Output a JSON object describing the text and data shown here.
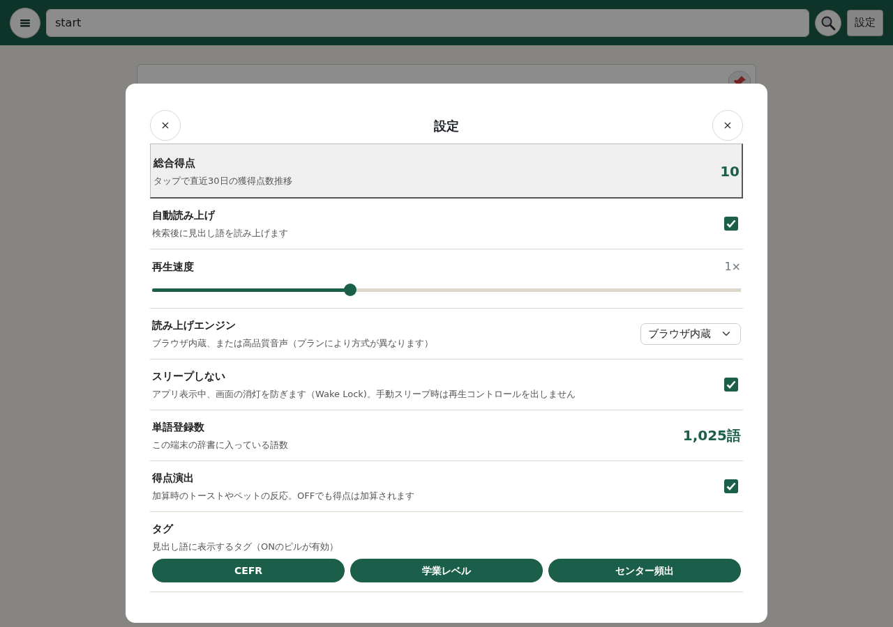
{
  "topbar": {
    "search_value": "start",
    "settings_button": "設定"
  },
  "modal": {
    "title": "設定",
    "close_buttons": [
      "×",
      "×"
    ],
    "rows": [
      {
        "kind": "score",
        "label": "総合得点",
        "description": "タップで直近30日の獲得点数推移",
        "value": "10",
        "selected": true
      },
      {
        "kind": "checkbox",
        "label": "自動読み上げ",
        "description": "検索後に見出し語を読み上げます",
        "checked": true
      },
      {
        "kind": "slider",
        "label": "再生速度",
        "reading": "1×",
        "level": 0.336
      },
      {
        "kind": "select",
        "label": "読み上げエンジン",
        "description": "ブラウザ内蔵、または高品質音声（プランにより方式が異なります）",
        "value": "ブラウザ内蔵"
      },
      {
        "kind": "checkbox",
        "label": "スリープしない",
        "description": "アプリ表示中、画面の消灯を防ぎます（Wake Lock)。手動スリープ時は再生コントロールを出しません",
        "checked": true
      },
      {
        "kind": "count",
        "label": "単語登録数",
        "description": "この端末の辞書に入っている語数",
        "value": "1,025語"
      },
      {
        "kind": "checkbox",
        "label": "得点演出",
        "description": "加算時のトーストやペットの反応。OFFでも得点は加算されます",
        "checked": true
      },
      {
        "kind": "tags",
        "label": "タグ",
        "description": "見出し語に表示するタグ（ONのピルが有効）",
        "tags": [
          {
            "label": "CEFR",
            "selected": true
          },
          {
            "label": "学業レベル",
            "selected": true
          },
          {
            "label": "センター頻出",
            "selected": true
          }
        ]
      }
    ]
  }
}
